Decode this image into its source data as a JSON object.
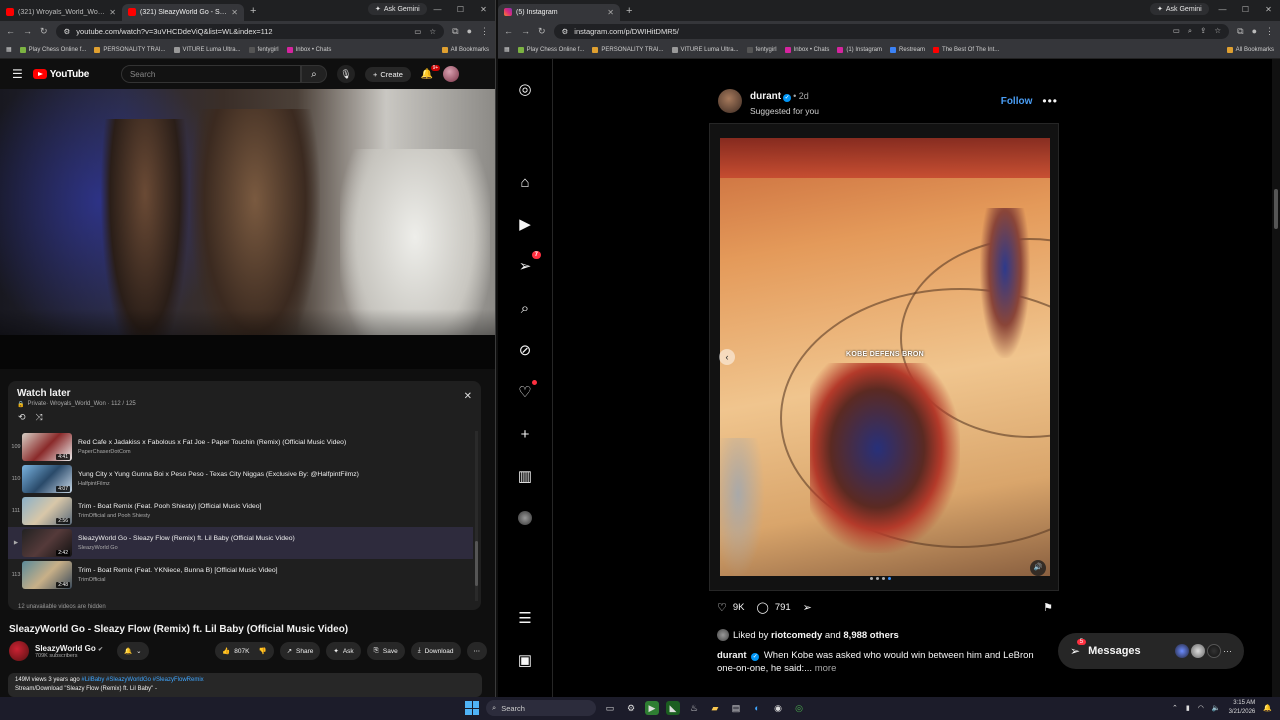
{
  "left_browser": {
    "tabs": [
      {
        "title": "(321) Wroyals_World_Won - Yo",
        "active": false
      },
      {
        "title": "(321) SleazyWorld Go - Sleazy",
        "active": true
      }
    ],
    "gemini": "Ask Gemini",
    "url": "youtube.com/watch?v=3uVHCDdeViQ&list=WL&index=112",
    "bookmarks": [
      "Play Chess Online f...",
      "PERSONALITY TRAI...",
      "VITURE Luma Ultra...",
      "fentygirl",
      "Inbox • Chats"
    ],
    "all_bookmarks": "All Bookmarks"
  },
  "youtube": {
    "logo": "YouTube",
    "search_placeholder": "Search",
    "create": "Create",
    "notif_count": "9+",
    "watch_later": {
      "title": "Watch later",
      "owner": "Private· Wroyals_World_Won · 112 / 125",
      "items": [
        {
          "idx": "109",
          "title": "Red Cafe x Jadakiss x Fabolous x Fat Joe - Paper Touchin (Remix) (Official Music Video)",
          "channel": "PaperChaserDotCom",
          "dur": "4:41",
          "current": false
        },
        {
          "idx": "110",
          "title": "Yung City x Yung Gunna Boi x Peso Peso - Texas City Niggas (Exclusive By: @HalfpintFilmz)",
          "channel": "HalfpintFilmz",
          "dur": "4:07",
          "current": false
        },
        {
          "idx": "111",
          "title": "Trim - Boat Remix (Feat. Pooh Shiesty) [Official Music Video]",
          "channel": "TrimOfficial and Pooh Shiesty",
          "dur": "2:56",
          "current": false
        },
        {
          "idx": "▶",
          "title": "SleazyWorld Go - Sleazy Flow (Remix) ft. Lil Baby (Official Music Video)",
          "channel": "SleazyWorld Go",
          "dur": "2:42",
          "current": true
        },
        {
          "idx": "113",
          "title": "Trim - Boat Remix (Feat. YKNiece, Bunna B) [Official Music Video]",
          "channel": "TrimOfficial",
          "dur": "2:48",
          "current": false
        }
      ],
      "hidden_note": "12 unavailable videos are hidden"
    },
    "video_title": "SleazyWorld Go - Sleazy Flow (Remix) ft. Lil Baby (Official Music Video)",
    "channel": "SleazyWorld Go",
    "subscribers": "709K subscribers",
    "likes": "807K",
    "share": "Share",
    "ask": "Ask",
    "save": "Save",
    "download": "Download",
    "desc_meta": "149M views  3 years ago ",
    "desc_tags": "#LilBaby #SleazyWorldGo #SleazyFlowRemix",
    "desc_line2": "Stream/Download \"Sleazy Flow (Remix) ft. Lil Baby\" -"
  },
  "right_browser": {
    "tab": "(5) Instagram",
    "gemini": "Ask Gemini",
    "url": "instagram.com/p/DWIHitDMR5/",
    "bookmarks": [
      "Play Chess Online f...",
      "PERSONALITY TRAI...",
      "VITURE Luma Ultra...",
      "fentygirl",
      "Inbox • Chats",
      "(1) Instagram",
      "Restream",
      "The Best Of The Int..."
    ],
    "all_bookmarks": "All Bookmarks"
  },
  "instagram": {
    "nav_badge": "7",
    "post": {
      "username": "durant",
      "time": "• 2d",
      "suggested": "Suggested for you",
      "follow": "Follow",
      "caption_overlay": "KOBE DEFENS BRON",
      "likes": "9K",
      "comments": "791",
      "liked_by_user": "riotcomedy",
      "liked_by_others": "8,988 others",
      "caption_user": "durant",
      "caption_text": " When Kobe was asked who would win between him and LeBron one-on-one, he said:...",
      "more": "more"
    },
    "messages": {
      "label": "Messages",
      "count": "5"
    }
  },
  "taskbar": {
    "search": "Search",
    "time": "3:15 AM",
    "date": "3/21/2026"
  },
  "colors": {
    "youtube_red": "#ff0000",
    "instagram_blue": "#0095f6",
    "accent": "#3ea6ff"
  }
}
